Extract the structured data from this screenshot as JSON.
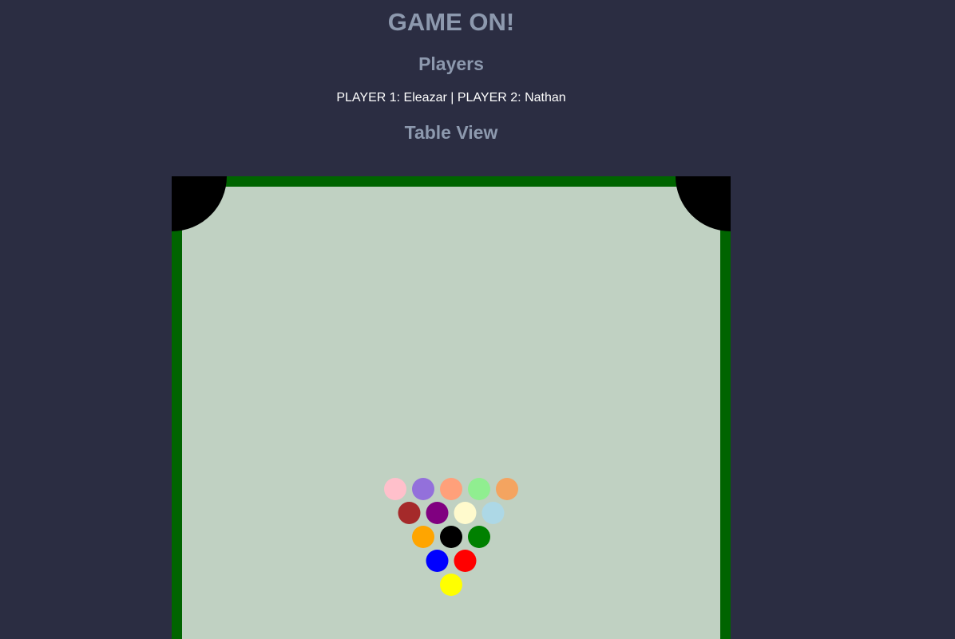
{
  "header": {
    "title": "GAME ON!",
    "players_heading": "Players",
    "player1_label": "PLAYER 1:",
    "player1_name": "Eleazar",
    "separator": "|",
    "player2_label": "PLAYER 2:",
    "player2_name": "Nathan",
    "table_heading": "Table View"
  },
  "colors": {
    "background": "#2b2d42",
    "heading": "#8d99ae",
    "rail": "#006400",
    "felt": "#c0d1c2",
    "pocket": "#000000"
  },
  "balls": [
    {
      "row": 0,
      "col": 0,
      "color": "#ffc0cb"
    },
    {
      "row": 0,
      "col": 1,
      "color": "#9370db"
    },
    {
      "row": 0,
      "col": 2,
      "color": "#ffa07a"
    },
    {
      "row": 0,
      "col": 3,
      "color": "#90ee90"
    },
    {
      "row": 0,
      "col": 4,
      "color": "#f4a460"
    },
    {
      "row": 1,
      "col": 0,
      "color": "#a52a2a"
    },
    {
      "row": 1,
      "col": 1,
      "color": "#800080"
    },
    {
      "row": 1,
      "col": 2,
      "color": "#fffacd"
    },
    {
      "row": 1,
      "col": 3,
      "color": "#add8e6"
    },
    {
      "row": 2,
      "col": 0,
      "color": "#ffa500"
    },
    {
      "row": 2,
      "col": 1,
      "color": "#000000"
    },
    {
      "row": 2,
      "col": 2,
      "color": "#008000"
    },
    {
      "row": 3,
      "col": 0,
      "color": "#0000ff"
    },
    {
      "row": 3,
      "col": 1,
      "color": "#ff0000"
    },
    {
      "row": 4,
      "col": 0,
      "color": "#ffff00"
    }
  ]
}
